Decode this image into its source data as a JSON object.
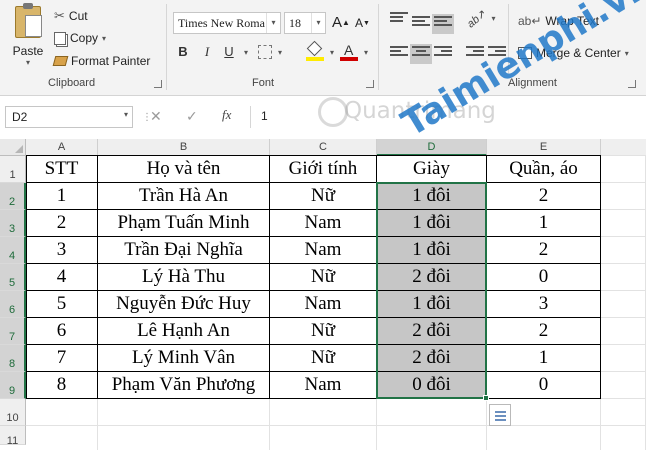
{
  "ribbon": {
    "clipboard": {
      "paste": "Paste",
      "cut": "Cut",
      "copy": "Copy",
      "format_painter": "Format Painter",
      "label": "Clipboard"
    },
    "font": {
      "family": "Times New Roma",
      "size": "18",
      "bold": "B",
      "italic": "I",
      "underline": "U",
      "grow": "A",
      "shrink": "A",
      "font_color_glyph": "A",
      "label": "Font",
      "highlight_color": "#ffeb00",
      "font_color": "#d00000"
    },
    "alignment": {
      "wrap_text": "Wrap Text",
      "merge_center": "Merge & Center",
      "label": "Alignment"
    }
  },
  "formula_bar": {
    "name_box": "D2",
    "fx": "fx",
    "value": "1"
  },
  "sheet": {
    "columns": [
      "A",
      "B",
      "C",
      "D",
      "E"
    ],
    "rows": [
      "1",
      "2",
      "3",
      "4",
      "5",
      "6",
      "7",
      "8",
      "9",
      "10",
      "11"
    ],
    "header": [
      "STT",
      "Họ và tên",
      "Giới tính",
      "Giày",
      "Quần, áo"
    ],
    "data": [
      [
        "1",
        "Trần Hà An",
        "Nữ",
        "1 đôi",
        "2"
      ],
      [
        "2",
        "Phạm Tuấn Minh",
        "Nam",
        "1 đôi",
        "1"
      ],
      [
        "3",
        "Trần Đại Nghĩa",
        "Nam",
        "1 đôi",
        "2"
      ],
      [
        "4",
        "Lý Hà Thu",
        "Nữ",
        "2 đôi",
        "0"
      ],
      [
        "5",
        "Nguyễn Đức Huy",
        "Nam",
        "1 đôi",
        "3"
      ],
      [
        "6",
        "Lê Hạnh An",
        "Nữ",
        "2 đôi",
        "2"
      ],
      [
        "7",
        "Lý Minh Vân",
        "Nữ",
        "2 đôi",
        "1"
      ],
      [
        "8",
        "Phạm Văn Phương",
        "Nam",
        "0 đôi",
        "0"
      ]
    ],
    "active_column": "D",
    "accent_color": "#217346"
  },
  "watermark": {
    "text1": "Quantrimang",
    "text2": "Taimienphi.vn"
  }
}
